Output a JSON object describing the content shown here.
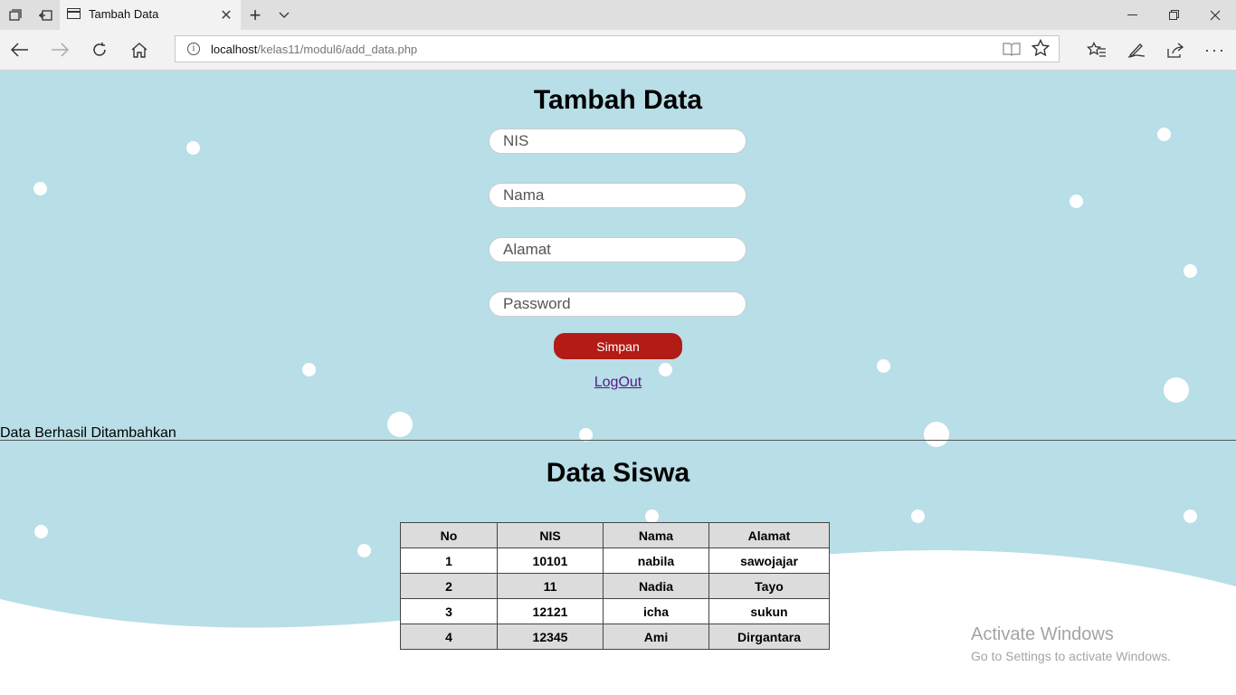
{
  "browser": {
    "tab_title": "Tambah Data",
    "url_host": "localhost",
    "url_path": "/kelas11/modul6/add_data.php"
  },
  "form": {
    "title": "Tambah Data",
    "nis_placeholder": "NIS",
    "nama_placeholder": "Nama",
    "alamat_placeholder": "Alamat",
    "password_placeholder": "Password",
    "submit_label": "Simpan",
    "logout_label": "LogOut"
  },
  "status_message": "Data Berhasil Ditambahkan",
  "table": {
    "title": "Data Siswa",
    "headers": [
      "No",
      "NIS",
      "Nama",
      "Alamat"
    ],
    "rows": [
      [
        "1",
        "10101",
        "nabila",
        "sawojajar"
      ],
      [
        "2",
        "11",
        "Nadia",
        "Tayo"
      ],
      [
        "3",
        "12121",
        "icha",
        "sukun"
      ],
      [
        "4",
        "12345",
        "Ami",
        "Dirgantara"
      ]
    ]
  },
  "watermark": {
    "title": "Activate Windows",
    "subtitle": "Go to Settings to activate Windows."
  },
  "colors": {
    "page_bg": "#b8dee7",
    "button": "#b31b16",
    "snow": "#ffffff"
  }
}
